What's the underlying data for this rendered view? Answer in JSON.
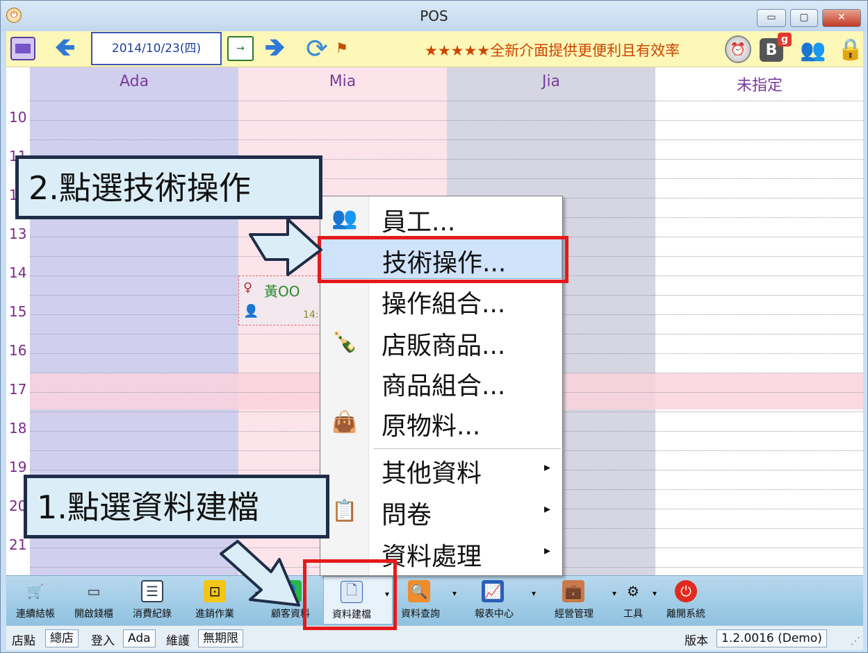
{
  "window": {
    "title": "POS"
  },
  "toolbar": {
    "date": "2014/10/23(四)",
    "marquee": "★★★★★全新介面提供更便利且有效率"
  },
  "schedule": {
    "columns": [
      "Ada",
      "Mia",
      "Jia",
      "未指定"
    ],
    "hours": [
      "10",
      "11",
      "12",
      "13",
      "14",
      "15",
      "16",
      "17",
      "18",
      "19",
      "20",
      "21"
    ],
    "appointment": {
      "customer": "黃OO",
      "time": "14:"
    }
  },
  "menu": {
    "items": [
      {
        "label": "員工...",
        "icon": "staff-icon"
      },
      {
        "label": "技術操作...",
        "icon": ""
      },
      {
        "label": "操作組合...",
        "icon": ""
      },
      {
        "label": "店販商品...",
        "icon": "bottles-icon"
      },
      {
        "label": "商品組合...",
        "icon": ""
      },
      {
        "label": "原物料...",
        "icon": "bag-icon"
      },
      {
        "label": "其他資料",
        "icon": ""
      },
      {
        "label": "問卷",
        "icon": "survey-icon"
      },
      {
        "label": "資料處理",
        "icon": ""
      }
    ],
    "submenu_arrow": "▸"
  },
  "callouts": {
    "step2": "2.點選技術操作",
    "step1": "1.點選資料建檔"
  },
  "bottombar": {
    "items": [
      {
        "label": "連續結帳",
        "icon": "checkout-icon"
      },
      {
        "label": "開啟錢櫃",
        "icon": "cash-drawer-icon"
      },
      {
        "label": "消費紀錄",
        "icon": "records-icon"
      },
      {
        "label": "進銷作業",
        "icon": "inventory-icon"
      },
      {
        "label": "顧客資料",
        "icon": "customer-icon"
      },
      {
        "label": "資料建檔",
        "icon": "data-file-icon"
      },
      {
        "label": "資料查詢",
        "icon": "search-icon"
      },
      {
        "label": "報表中心",
        "icon": "report-icon"
      },
      {
        "label": "經營管理",
        "icon": "management-icon"
      },
      {
        "label": "工具",
        "icon": "gear-icon"
      },
      {
        "label": "離開系統",
        "icon": "power-icon"
      }
    ]
  },
  "statusbar": {
    "store_label": "店點",
    "store_value": "總店",
    "login_label": "登入",
    "login_value": "Ada",
    "maint_label": "維護",
    "maint_value": "無期限",
    "version_label": "版本",
    "version_value": "1.2.0016 (Demo)"
  },
  "colors": {
    "highlight": "#e41a1a",
    "callout_bg": "#dbeef8",
    "menu_active": "#cfe3fb"
  }
}
